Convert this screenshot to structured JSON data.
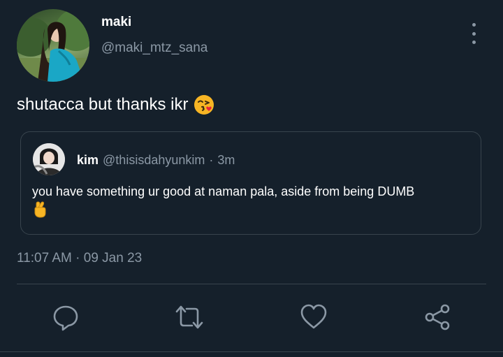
{
  "user": {
    "display_name": "maki",
    "handle": "@maki_mtz_sana"
  },
  "tweet": {
    "text": "shutacca but thanks ikr",
    "emoji": "😘",
    "timestamp": "11:07 AM · 09 Jan 23"
  },
  "quoted": {
    "name": "kim",
    "handle": "@thisisdahyunkim",
    "separator": "·",
    "time": "3m",
    "text": "you have something ur good at naman pala, aside from being DUMB",
    "emoji": "🤞"
  },
  "actions": [
    "reply-icon",
    "retweet-icon",
    "like-icon",
    "share-icon"
  ],
  "colors": {
    "background": "#15202b",
    "secondary_text": "#8b98a5",
    "border": "#38444d"
  }
}
